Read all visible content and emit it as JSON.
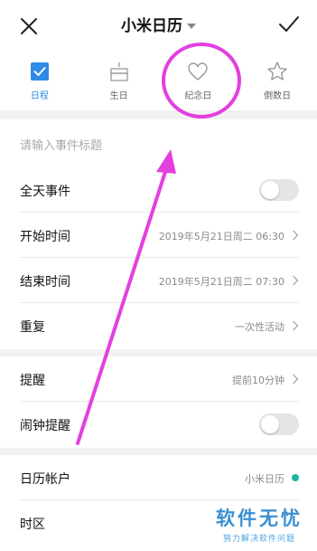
{
  "header": {
    "title": "小米日历",
    "close_icon": "close-icon",
    "confirm_icon": "check-icon"
  },
  "tabs": [
    {
      "label": "日程",
      "icon": "checkbox-icon",
      "active": true
    },
    {
      "label": "生日",
      "icon": "cake-icon",
      "active": false
    },
    {
      "label": "纪念日",
      "icon": "heart-icon",
      "active": false
    },
    {
      "label": "倒数日",
      "icon": "star-icon",
      "active": false
    }
  ],
  "event": {
    "title_placeholder": "请输入事件标题"
  },
  "rows": {
    "all_day": {
      "label": "全天事件",
      "on": false
    },
    "start": {
      "label": "开始时间",
      "value": "2019年5月21日周二 06:30"
    },
    "end": {
      "label": "结束时间",
      "value": "2019年5月21日周二 07:30"
    },
    "repeat": {
      "label": "重复",
      "value": "一次性活动"
    },
    "reminder": {
      "label": "提醒",
      "value": "提前10分钟"
    },
    "alarm": {
      "label": "闹钟提醒",
      "on": false
    },
    "account": {
      "label": "日历帐户",
      "value": "小米日历"
    },
    "timezone": {
      "label": "时区"
    }
  },
  "annotation": {
    "color": "#e43fdf"
  },
  "watermark": {
    "main": "软件无忧",
    "sub": "努力解决软件问题"
  },
  "colors": {
    "accent": "#2f8be5",
    "account_dot": "#21b3a4"
  }
}
